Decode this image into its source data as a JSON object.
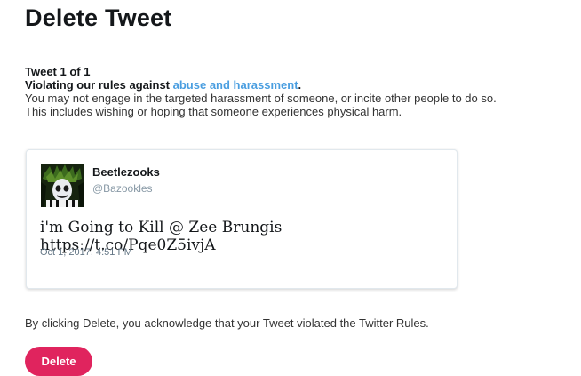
{
  "page": {
    "title": "Delete Tweet"
  },
  "violation": {
    "counter": "Tweet 1 of 1",
    "rule_prefix": "Violating our rules against ",
    "rule_link": "abuse and harassment",
    "rule_suffix": ".",
    "description_line1": "You may not engage in the targeted harassment of someone, or incite other people to do so.",
    "description_line2": "This includes wishing or hoping that someone experiences physical harm."
  },
  "tweet": {
    "avatar_icon": "beetlejuice-avatar",
    "author_name": "Beetlezooks",
    "author_handle": "@Bazookles",
    "text": "i'm Going to Kill @ Zee Brungis https://t.co/Pqe0Z5ivjA",
    "timestamp": "Oct 1, 2017, 4:51 PM"
  },
  "footer": {
    "acknowledgement": "By clicking Delete, you acknowledge that your Tweet violated the Twitter Rules.",
    "delete_label": "Delete"
  },
  "colors": {
    "link": "#4a9ee0",
    "delete_button": "#e0245e",
    "handle": "#8899a6"
  }
}
